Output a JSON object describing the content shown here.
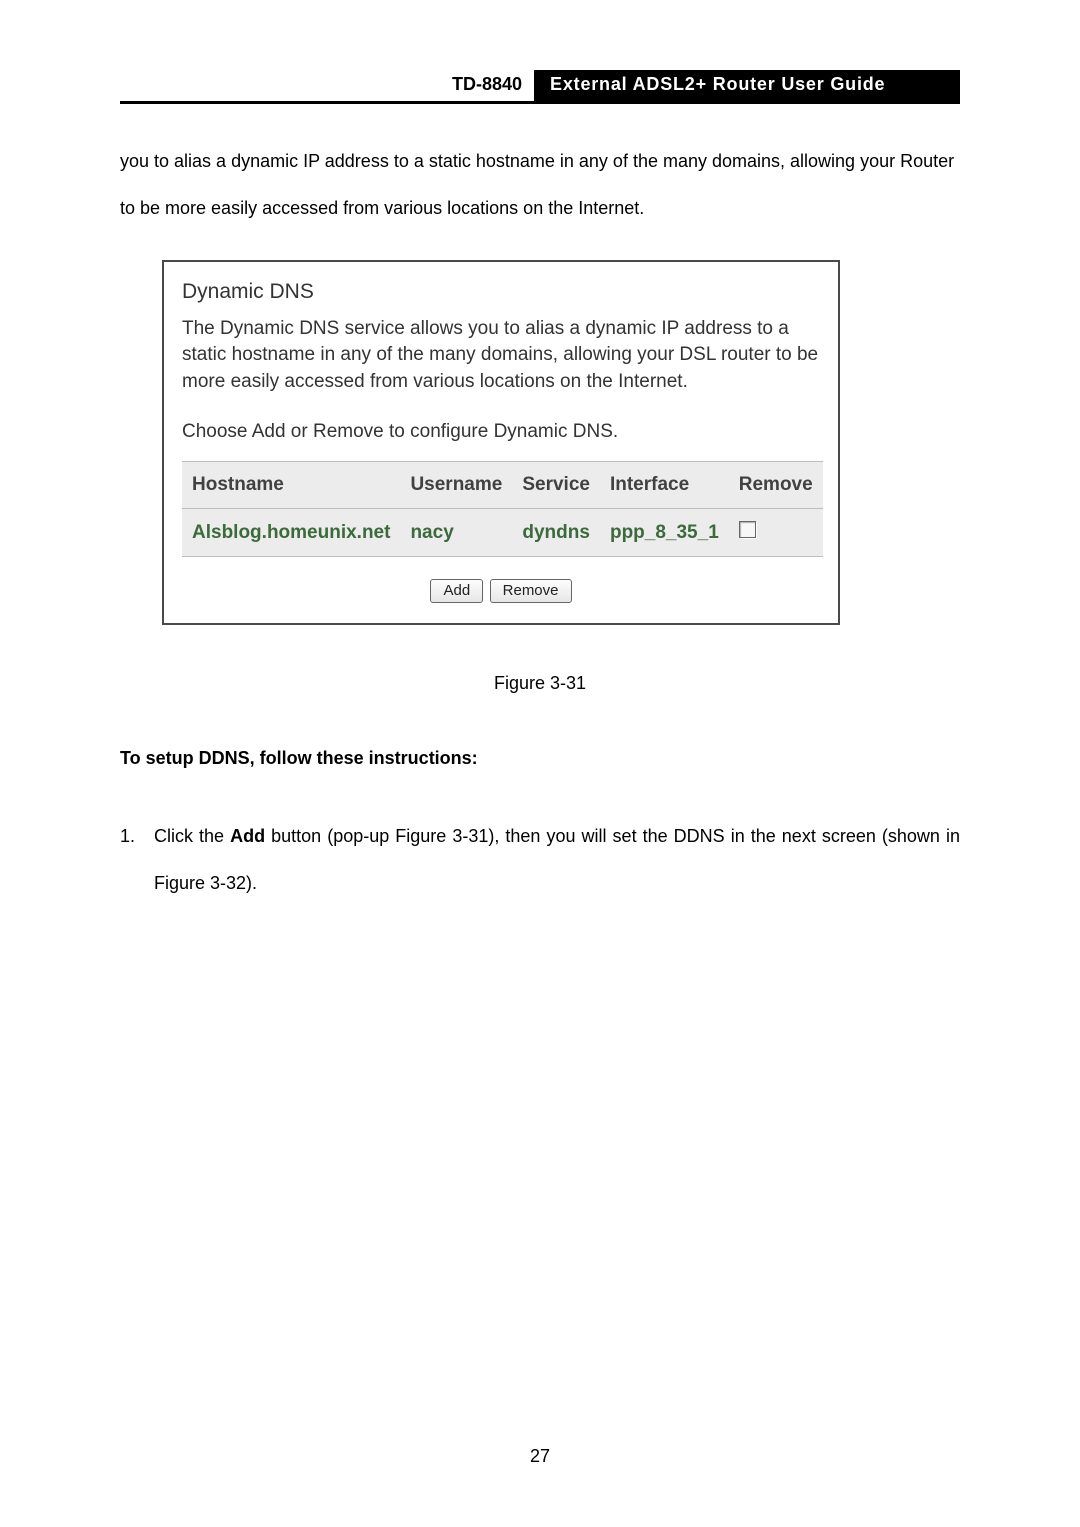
{
  "header": {
    "model": "TD-8840",
    "guide_title": "External  ADSL2+  Router  User  Guide"
  },
  "intro_para": "you to alias a dynamic IP address to a static hostname in any of the many domains, allowing your Router to be more easily accessed from various locations on the Internet.",
  "panel": {
    "title": "Dynamic DNS",
    "description": "The Dynamic DNS service allows you to alias a dynamic IP address to a static hostname in any of the many domains, allowing your DSL router to be more easily accessed from various locations on the Internet.",
    "instruction": "Choose Add or Remove to configure Dynamic DNS.",
    "columns": {
      "hostname": "Hostname",
      "username": "Username",
      "service": "Service",
      "interface": "Interface",
      "remove": "Remove"
    },
    "rows": [
      {
        "hostname": "Alsblog.homeunix.net",
        "username": "nacy",
        "service": "dyndns",
        "interface": "ppp_8_35_1"
      }
    ],
    "buttons": {
      "add": "Add",
      "remove": "Remove"
    }
  },
  "figure_caption": "Figure 3-31",
  "setup_heading": "To setup DDNS, follow these instructions:",
  "step1": {
    "number": "1.",
    "prefix": "Click the ",
    "bold1": "Add",
    "mid": " button (pop-up Figure 3-31), then you will set the DDNS in the next screen (shown in Figure 3-32)."
  },
  "page_number": "27"
}
